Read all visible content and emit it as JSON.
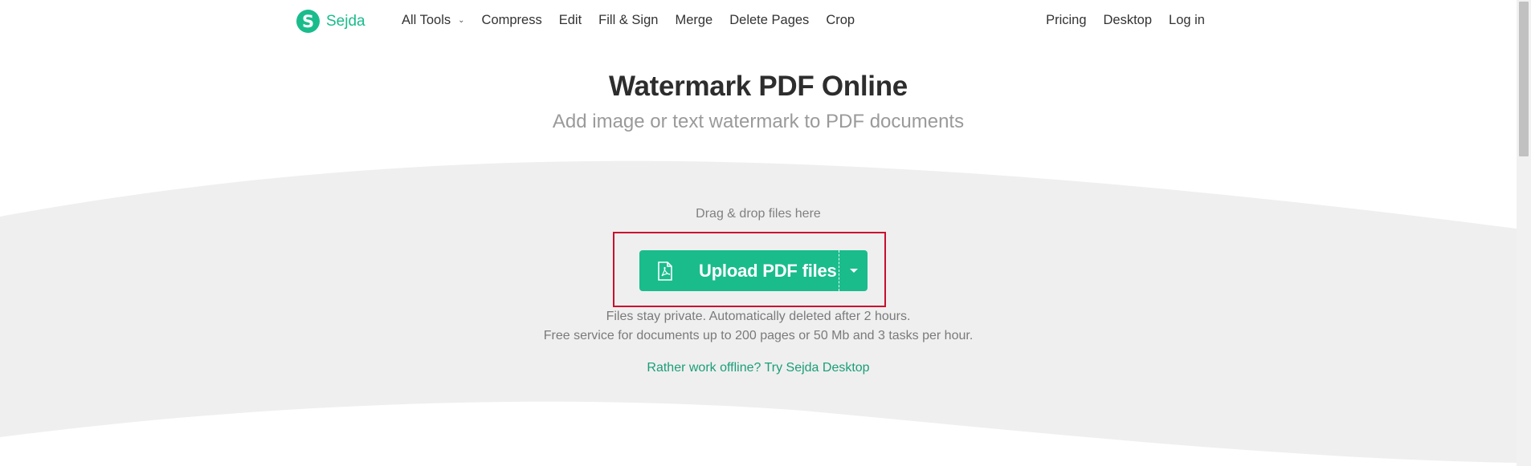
{
  "brand": {
    "name": "Sejda",
    "logo_letter": "S",
    "color": "#1abc8c"
  },
  "nav": {
    "left": [
      {
        "label": "All Tools",
        "has_dropdown": true
      },
      {
        "label": "Compress"
      },
      {
        "label": "Edit"
      },
      {
        "label": "Fill & Sign"
      },
      {
        "label": "Merge"
      },
      {
        "label": "Delete Pages"
      },
      {
        "label": "Crop"
      }
    ],
    "right": [
      {
        "label": "Pricing"
      },
      {
        "label": "Desktop"
      },
      {
        "label": "Log in"
      }
    ]
  },
  "hero": {
    "title": "Watermark PDF Online",
    "subtitle": "Add image or text watermark to PDF documents"
  },
  "upload": {
    "drag_text": "Drag & drop files here",
    "button_label": "Upload PDF files",
    "button_icon": "pdf-file-icon",
    "info_line_1": "Files stay private. Automatically deleted after 2 hours.",
    "info_line_2": "Free service for documents up to 200 pages or 50 Mb and 3 tasks per hour.",
    "offline_link": "Rather work offline? Try Sejda Desktop",
    "highlight_color": "#c8102e"
  }
}
